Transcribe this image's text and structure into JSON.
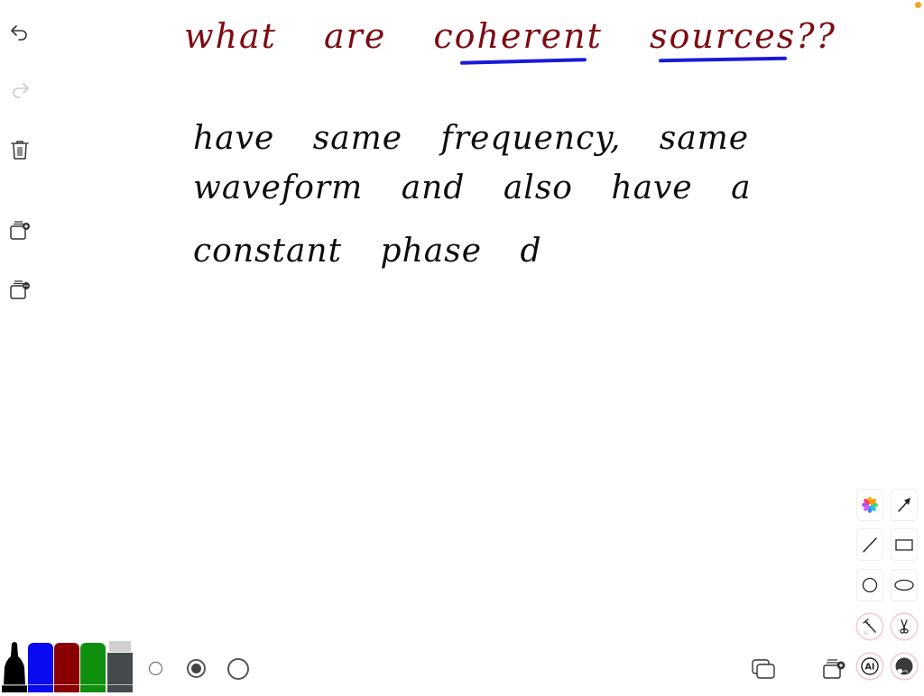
{
  "left_toolbar": {
    "items": [
      {
        "name": "undo",
        "icon": "undo-icon",
        "enabled": true
      },
      {
        "name": "redo",
        "icon": "redo-icon",
        "enabled": false
      },
      {
        "name": "delete",
        "icon": "trash-icon",
        "enabled": true
      },
      {
        "name": "add-page",
        "icon": "add-page-icon",
        "enabled": true
      },
      {
        "name": "page-options",
        "icon": "page-more-icon",
        "enabled": true
      }
    ]
  },
  "canvas": {
    "title": "what are coherent sources??",
    "underlined_words": [
      "coherent",
      "sources"
    ],
    "lines": [
      "have same frequency, same",
      "waveform and also have a",
      "constant phase d"
    ],
    "colors": {
      "title_ink": "#7d0b12",
      "body_ink": "#0d0d0d",
      "underline_ink": "#1a1ad8"
    }
  },
  "pen_tray": {
    "tools": [
      {
        "name": "black-marker",
        "color": "#000000"
      },
      {
        "name": "blue-pen",
        "color": "#0a0af0"
      },
      {
        "name": "red-pen",
        "color": "#8a0000"
      },
      {
        "name": "green-pen",
        "color": "#0e8f0e"
      },
      {
        "name": "eraser",
        "color": "#444a4c"
      }
    ],
    "stroke_sizes": [
      "small",
      "medium",
      "large"
    ],
    "selected_size": "medium"
  },
  "bottom_right": {
    "items": [
      {
        "name": "pages",
        "icon": "pages-icon"
      },
      {
        "name": "add-page",
        "icon": "add-page-icon"
      }
    ]
  },
  "tool_palette": {
    "items": [
      {
        "name": "photos",
        "icon": "photos-icon"
      },
      {
        "name": "arrow",
        "icon": "arrow-icon"
      },
      {
        "name": "line",
        "icon": "line-icon"
      },
      {
        "name": "rectangle",
        "icon": "rectangle-icon"
      },
      {
        "name": "circle",
        "icon": "circle-icon"
      },
      {
        "name": "ellipse",
        "icon": "ellipse-icon"
      },
      {
        "name": "ruler",
        "icon": "ruler-icon"
      },
      {
        "name": "cut",
        "icon": "scissors-icon"
      },
      {
        "name": "ai",
        "icon": "ai-icon",
        "label": "AI"
      },
      {
        "name": "avatar",
        "icon": "avatar-icon"
      }
    ]
  }
}
